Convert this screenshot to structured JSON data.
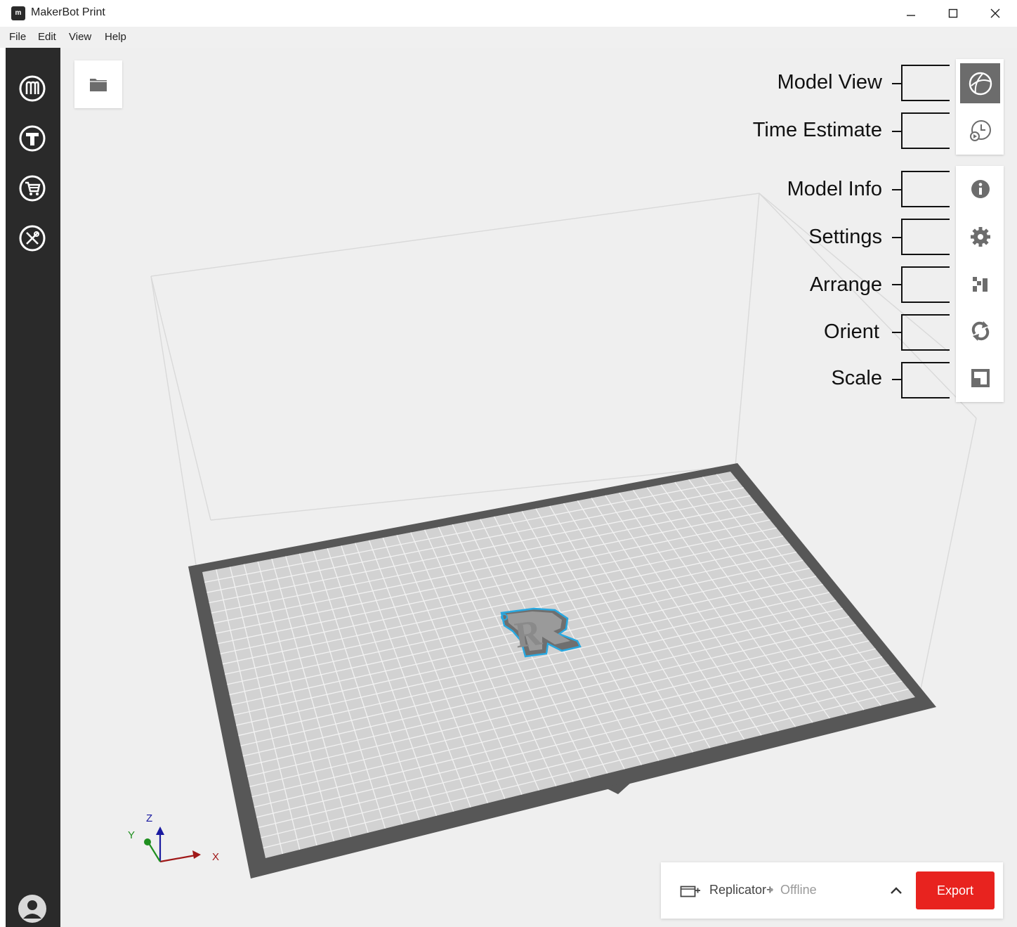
{
  "window": {
    "title": "MakerBot Print",
    "app_icon": "makerbot-logo-icon",
    "controls": [
      "minimize-icon",
      "maximize-icon",
      "close-icon"
    ]
  },
  "menu": [
    "File",
    "Edit",
    "View",
    "Help"
  ],
  "sidebar": {
    "items": [
      {
        "name": "makerbot-logo-icon"
      },
      {
        "name": "thingiverse-icon"
      },
      {
        "name": "store-cart-icon"
      },
      {
        "name": "tools-icon"
      }
    ],
    "account_icon": "user-avatar-icon"
  },
  "toolbar": {
    "open_icon": "folder-icon",
    "view_tools": [
      {
        "label": "Model View",
        "icon": "sphere-icon",
        "active": true
      },
      {
        "label": "Time Estimate",
        "icon": "clock-play-icon",
        "active": false
      }
    ],
    "edit_tools": [
      {
        "label": "Model Info",
        "icon": "info-icon"
      },
      {
        "label": "Settings",
        "icon": "gear-icon"
      },
      {
        "label": "Arrange",
        "icon": "arrange-icon"
      },
      {
        "label": "Orient",
        "icon": "rotate-icon"
      },
      {
        "label": "Scale",
        "icon": "scale-icon"
      }
    ]
  },
  "axes": {
    "x": "X",
    "y": "Y",
    "z": "Z"
  },
  "printer": {
    "name": "Replicator+",
    "separator": "•",
    "status": "Offline",
    "export_label": "Export"
  },
  "colors": {
    "sidebar": "#2a2a2a",
    "viewport": "#efefef",
    "active_tool": "#6c6c6c",
    "export": "#e8231f",
    "model_outline": "#29a8e0",
    "axis_x": "#a01818",
    "axis_y": "#1f8f1f",
    "axis_z": "#1a1aa0"
  }
}
